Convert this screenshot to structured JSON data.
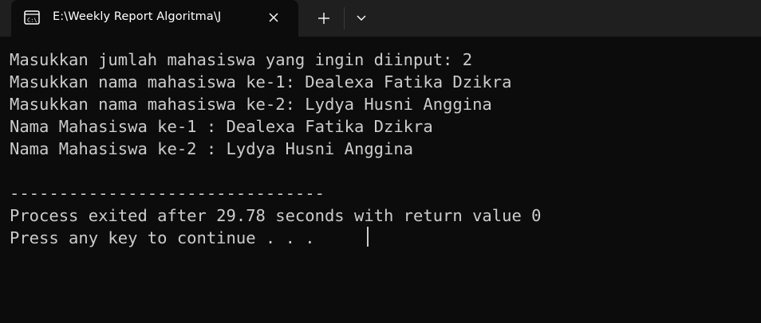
{
  "window": {
    "tab_title": "E:\\Weekly Report Algoritma\\J",
    "icons": {
      "tab": "console-icon",
      "close": "close-icon",
      "new_tab": "plus-icon",
      "dropdown": "chevron-down-icon"
    },
    "colors": {
      "background": "#0c0c0c",
      "titlebar": "#1f1f1f",
      "text": "#cccccc"
    }
  },
  "console": {
    "lines": [
      "Masukkan jumlah mahasiswa yang ingin diinput: 2",
      "Masukkan nama mahasiswa ke-1: Dealexa Fatika Dzikra",
      "Masukkan nama mahasiswa ke-2: Lydya Husni Anggina",
      "Nama Mahasiswa ke-1 : Dealexa Fatika Dzikra",
      "Nama Mahasiswa ke-2 : Lydya Husni Anggina",
      "",
      "--------------------------------",
      "Process exited after 29.78 seconds with return value 0",
      "Press any key to continue . . . "
    ]
  }
}
